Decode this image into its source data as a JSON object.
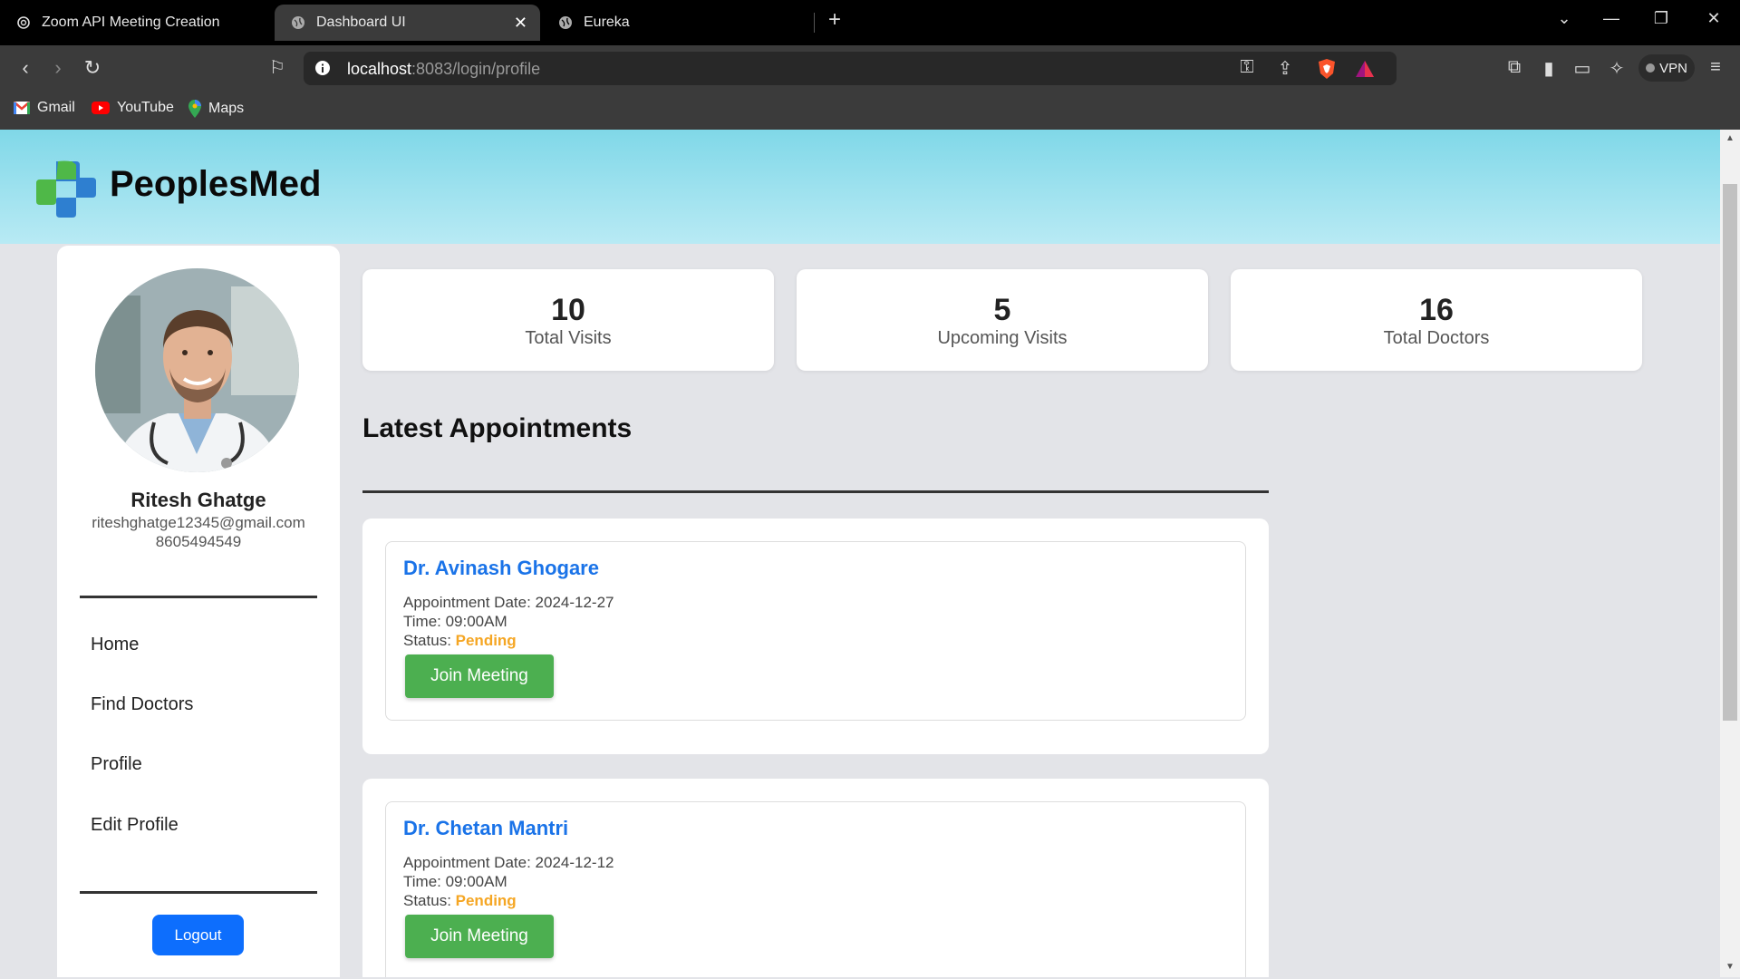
{
  "browser": {
    "tabs": [
      {
        "title": "Zoom API Meeting Creation",
        "icon": "openai-icon",
        "active": false
      },
      {
        "title": "Dashboard UI",
        "icon": "globe-icon",
        "active": true
      },
      {
        "title": "Eureka",
        "icon": "globe-icon",
        "active": false
      }
    ],
    "url_host": "localhost",
    "url_rest": ":8083/login/profile",
    "vpn_label": "VPN",
    "bookmarks": [
      {
        "label": "Gmail",
        "icon": "gmail-icon"
      },
      {
        "label": "YouTube",
        "icon": "youtube-icon"
      },
      {
        "label": "Maps",
        "icon": "maps-icon"
      }
    ]
  },
  "app": {
    "brand": "PeoplesMed",
    "colors": {
      "link": "#1a73e8",
      "pending": "#f5a623",
      "join": "#4caf50",
      "logout": "#0d6efd"
    }
  },
  "profile": {
    "name": "Ritesh Ghatge",
    "email": "riteshghatge12345@gmail.com",
    "phone": "8605494549"
  },
  "nav": {
    "items": [
      "Home",
      "Find Doctors",
      "Profile",
      "Edit Profile"
    ],
    "logout": "Logout"
  },
  "stats": [
    {
      "value": "10",
      "label": "Total Visits"
    },
    {
      "value": "5",
      "label": "Upcoming Visits"
    },
    {
      "value": "16",
      "label": "Total Doctors"
    }
  ],
  "appointments_title": "Latest Appointments",
  "appointments": [
    {
      "doctor": "Dr. Avinash Ghogare",
      "date_label": "Appointment Date: 2024-12-27",
      "time_label": "Time: 09:00AM",
      "status_label": "Status: ",
      "status": "Pending",
      "button": "Join Meeting"
    },
    {
      "doctor": "Dr. Chetan Mantri",
      "date_label": "Appointment Date: 2024-12-12",
      "time_label": "Time: 09:00AM",
      "status_label": "Status: ",
      "status": "Pending",
      "button": "Join Meeting"
    }
  ]
}
